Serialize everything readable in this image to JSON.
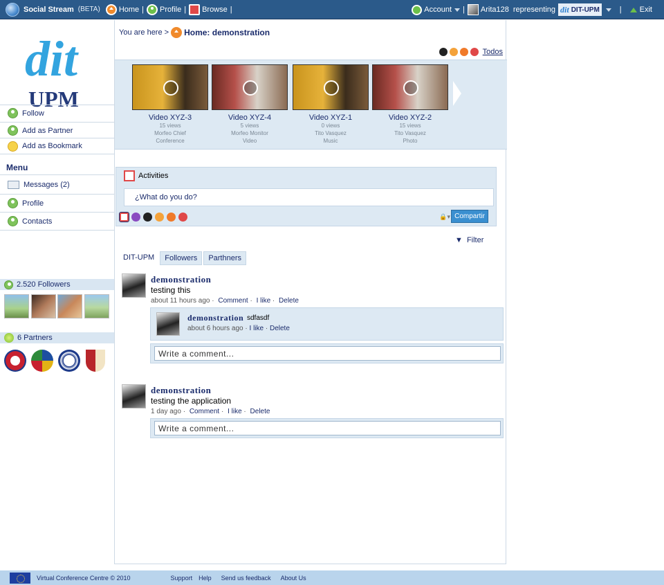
{
  "topbar": {
    "brand": "Social Stream",
    "beta": "(BETA)",
    "nav": [
      {
        "label": "Home",
        "icon": "home-icon"
      },
      {
        "label": "Profile",
        "icon": "profile-icon"
      },
      {
        "label": "Browse",
        "icon": "browse-icon"
      }
    ],
    "account_label": "Account",
    "username": "Arita128",
    "representing_label": "representing",
    "representing_entity": "DIT-UPM",
    "exit_label": "Exit"
  },
  "sidebar": {
    "logo_text_1": "dit",
    "logo_text_2": "UPM",
    "actions": [
      {
        "label": "Follow",
        "icon": "follow-icon"
      },
      {
        "label": "Add as Partner",
        "icon": "partner-icon"
      },
      {
        "label": "Add as Bookmark",
        "icon": "bookmark-icon"
      }
    ],
    "menu_title": "Menu",
    "menu": [
      {
        "label": "Messages (2)",
        "icon": "envelope-icon"
      },
      {
        "label": "Profile",
        "icon": "profile-icon"
      },
      {
        "label": "Contacts",
        "icon": "contacts-icon"
      }
    ],
    "followers_label": "2.520 Followers",
    "partners_label": "6 Partners"
  },
  "main": {
    "breadcrumb_prefix": "You are here >",
    "breadcrumb_current": "Home: demonstration",
    "todos_label": "Todos",
    "videos": [
      {
        "title": "Video XYZ-3",
        "views": "15 views",
        "line1": "Morfeo Chief",
        "line2": "Conference"
      },
      {
        "title": "Video XYZ-4",
        "views": "5 views",
        "line1": "Morfeo Monitor",
        "line2": "Video"
      },
      {
        "title": "Video XYZ-1",
        "views": "0 views",
        "line1": "Tito Vasquez",
        "line2": "Music"
      },
      {
        "title": "Video XYZ-2",
        "views": "15 views",
        "line1": "Tito Vasquez",
        "line2": "Photo"
      }
    ],
    "activities_title": "Activities",
    "activities_placeholder": "¿What do you do?",
    "share_button": "Compartir",
    "filter_label": "Filter",
    "tabs": [
      "DIT-UPM",
      "Followers",
      "Parthners"
    ],
    "posts": [
      {
        "author": "demonstration",
        "text": "testing this",
        "time": "about 11 hours ago",
        "actions": [
          "Comment",
          "I like",
          "Delete"
        ],
        "comment": {
          "author": "demonstration",
          "text": "sdfasdf",
          "time": "about 6 hours ago",
          "actions": [
            "I like",
            "Delete"
          ]
        },
        "comment_placeholder": "Write a comment..."
      },
      {
        "author": "demonstration",
        "text": "testing the application",
        "time": "1 day ago",
        "actions": [
          "Comment",
          "I like",
          "Delete"
        ],
        "comment_placeholder": "Write a comment..."
      }
    ]
  },
  "footer": {
    "copyright": "Virtual Conference Centre © 2010",
    "links": [
      "Support",
      "Help",
      "Send us feedback",
      "About Us"
    ]
  }
}
